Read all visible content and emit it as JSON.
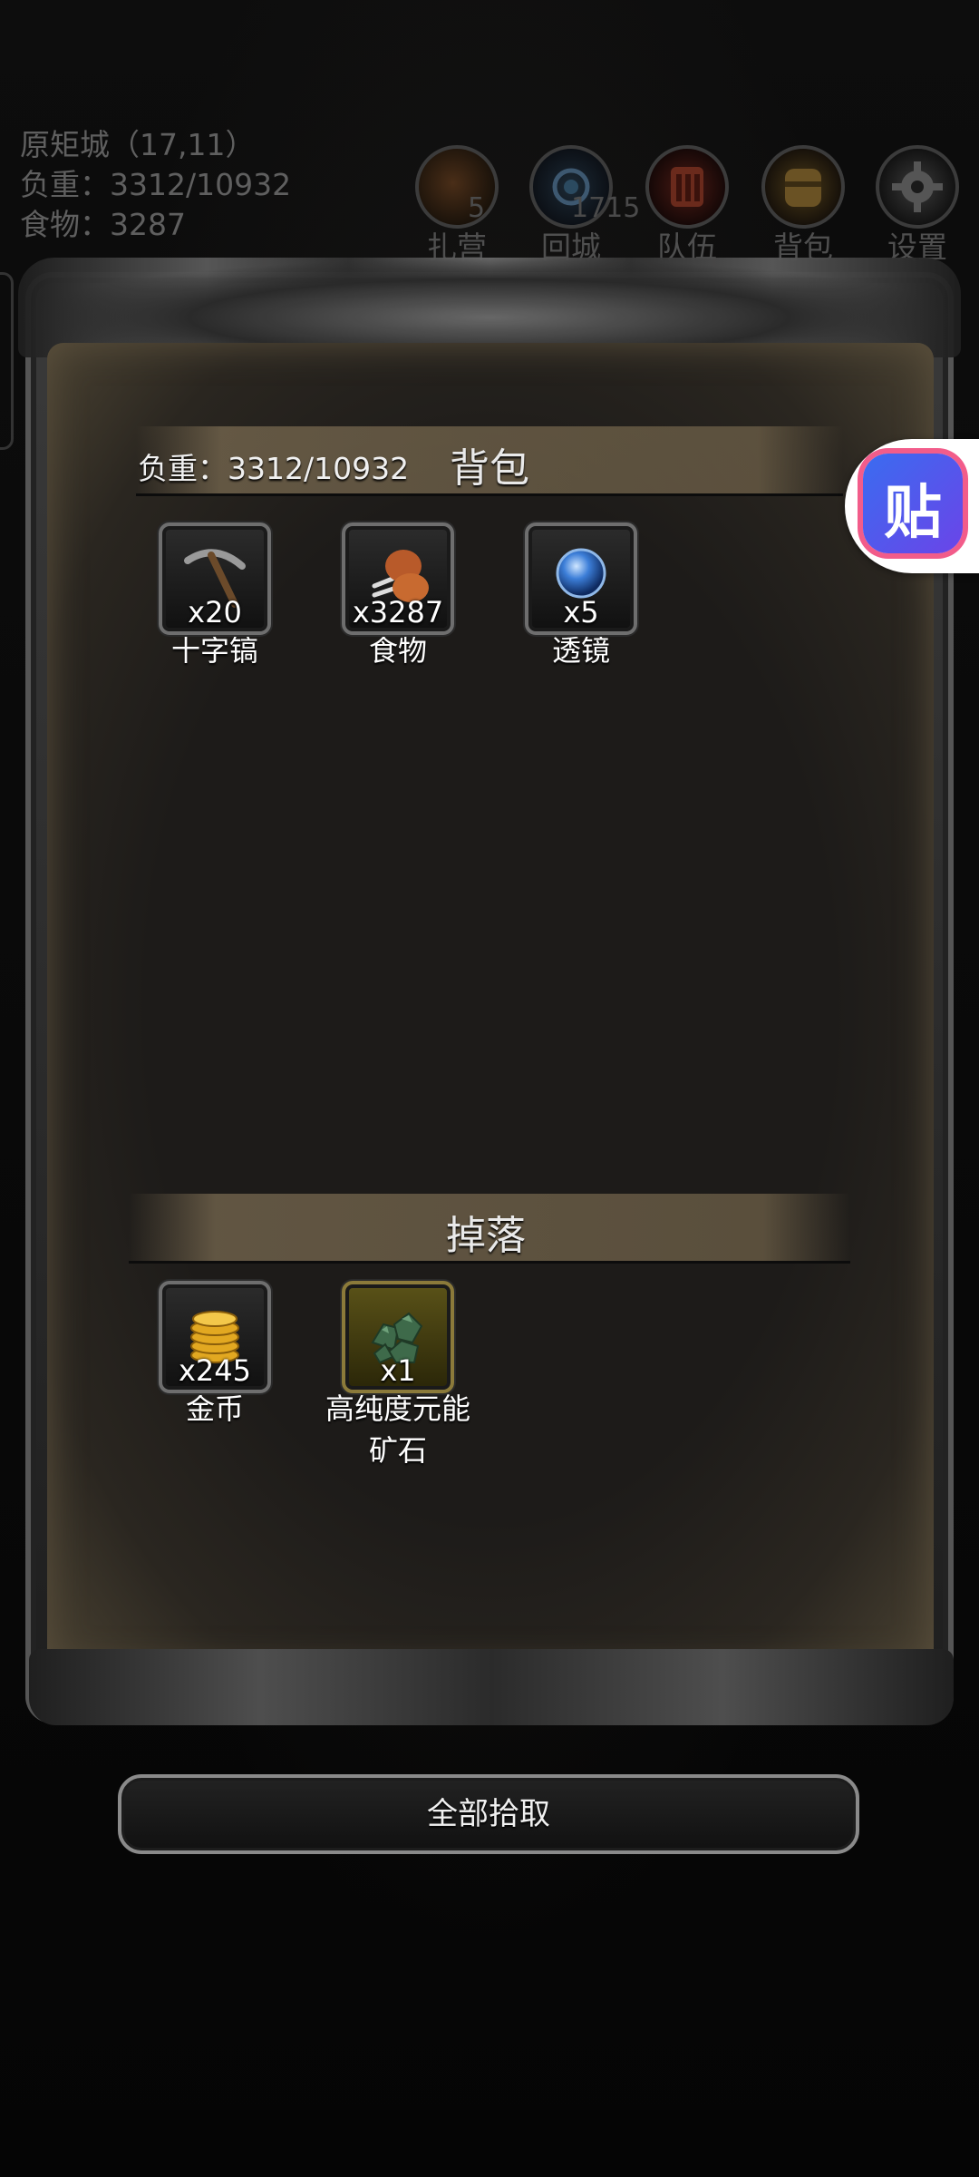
{
  "hud": {
    "location": "原矩城（17,11）",
    "load": "负重：3312/10932",
    "food": "食物：3287"
  },
  "hud_buttons": [
    {
      "label": "扎营",
      "count": "5",
      "icon": "campfire-icon"
    },
    {
      "label": "回城",
      "count": "1715",
      "icon": "portal-icon"
    },
    {
      "label": "队伍",
      "count": "",
      "icon": "team-icon"
    },
    {
      "label": "背包",
      "count": "",
      "icon": "backpack-icon"
    },
    {
      "label": "设置",
      "count": "",
      "icon": "gear-icon"
    }
  ],
  "bag": {
    "title": "背包",
    "load": "负重：3312/10932",
    "items": [
      {
        "name": "十字镐",
        "qty": "x20",
        "icon": "pickaxe-icon"
      },
      {
        "name": "食物",
        "qty": "x3287",
        "icon": "meat-icon"
      },
      {
        "name": "透镜",
        "qty": "x5",
        "icon": "lens-icon"
      }
    ]
  },
  "drop": {
    "title": "掉落",
    "items": [
      {
        "name": "金币",
        "qty": "x245",
        "icon": "gold-coins-icon"
      },
      {
        "name": "高纯度元能矿石",
        "qty": "x1",
        "icon": "ore-icon"
      }
    ]
  },
  "pickup_all_label": "全部拾取",
  "floating_badge": {
    "glyph": "贴",
    "icon": "sticker-icon"
  }
}
